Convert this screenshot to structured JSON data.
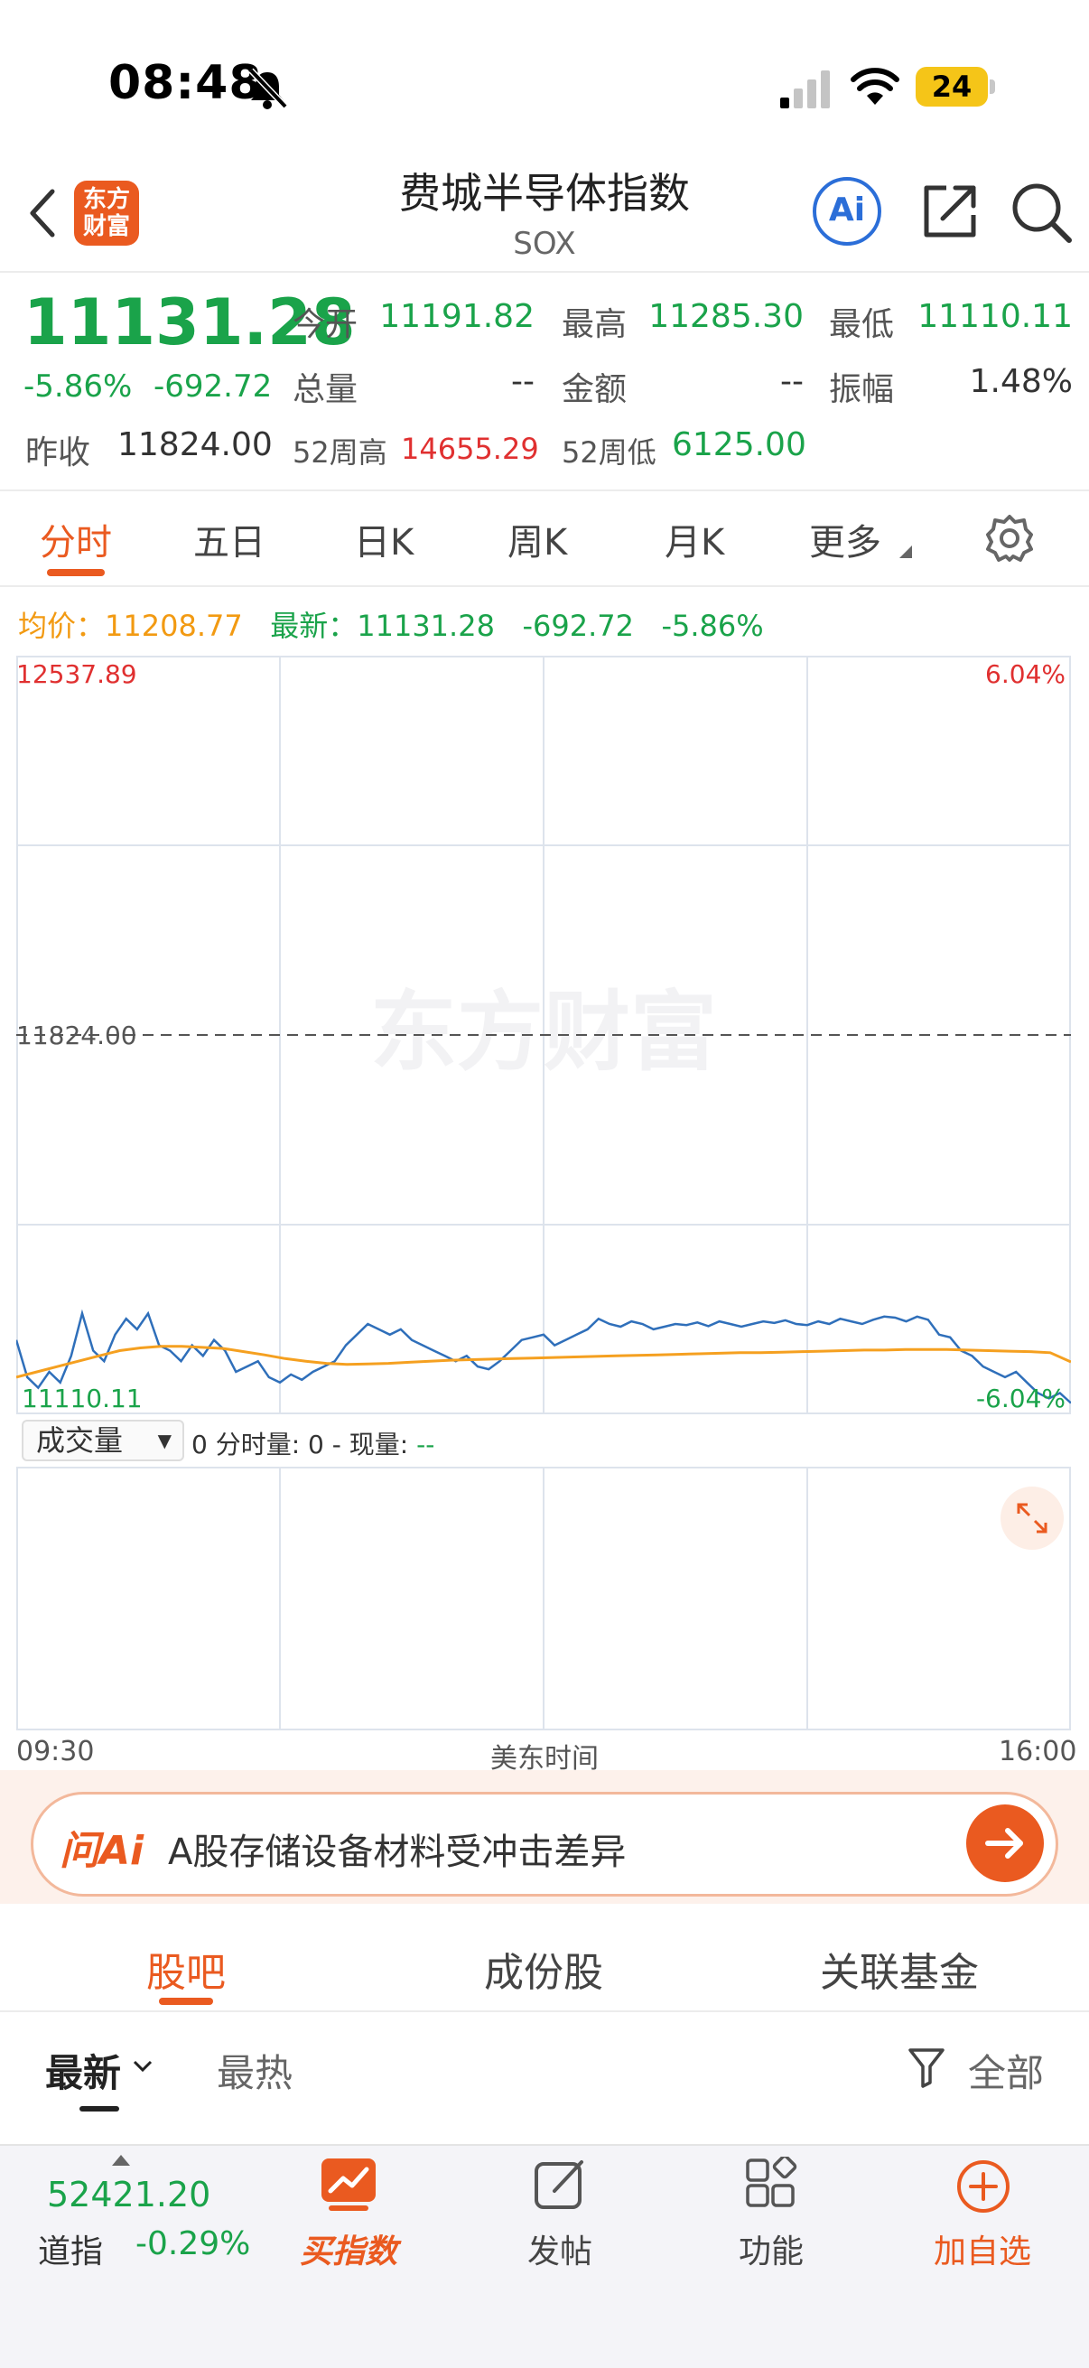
{
  "status_bar": {
    "time": "08:48",
    "battery": "24"
  },
  "header": {
    "logo_line1": "东方",
    "logo_line2": "财富",
    "title": "费城半导体指数",
    "subtitle": "SOX",
    "ai_label": "Ai"
  },
  "quote": {
    "price": "11131.28",
    "change_pct": "-5.86%",
    "change": "-692.72",
    "prev_close_label": "昨收",
    "prev_close": "11824.00",
    "open_label": "今开",
    "open": "11191.82",
    "high_label": "最高",
    "high": "11285.30",
    "low_label": "最低",
    "low": "11110.11",
    "volume_label": "总量",
    "volume": "--",
    "amount_label": "金额",
    "amount": "--",
    "amplitude_label": "振幅",
    "amplitude": "1.48%",
    "w52_high_label": "52周高",
    "w52_high": "14655.29",
    "w52_low_label": "52周低",
    "w52_low": "6125.00"
  },
  "tabs": [
    "分时",
    "五日",
    "日K",
    "周K",
    "月K",
    "更多"
  ],
  "avg_bar": {
    "avg_label": "均价：",
    "avg": "11208.77",
    "latest_label": "最新：",
    "latest": "11131.28",
    "change": "-692.72",
    "change_pct": "-5.86%"
  },
  "chart_data": {
    "type": "line",
    "y_top": "12537.89",
    "y_mid": "11824.00",
    "y_bottom": "11110.11",
    "pct_top": "6.04%",
    "pct_bottom": "-6.04%",
    "ylim": [
      11110.11,
      12537.89
    ],
    "watermark": "东方财富",
    "series": [
      {
        "values": [
          11250,
          11180,
          11160,
          11190,
          11170,
          11220,
          11300,
          11230,
          11210,
          11260,
          11290,
          11270,
          11300,
          11240,
          11230,
          11210,
          11240,
          11220,
          11250,
          11230,
          11190,
          11200,
          11210,
          11180,
          11170,
          11185,
          11175,
          11190,
          11200,
          11210,
          11240,
          11260,
          11280,
          11270,
          11260,
          11270,
          11250,
          11240,
          11230,
          11220,
          11210,
          11220,
          11200,
          11195,
          11210,
          11230,
          11250,
          11255,
          11260,
          11240,
          11250,
          11260,
          11270,
          11290,
          11280,
          11275,
          11285,
          11280,
          11270,
          11275,
          11280,
          11278,
          11283,
          11276,
          11285,
          11280,
          11275,
          11280,
          11285,
          11282,
          11287,
          11280,
          11278,
          11285,
          11280,
          11290,
          11285,
          11280,
          11288,
          11294,
          11292,
          11285,
          11294,
          11288,
          11260,
          11255,
          11230,
          11220,
          11200,
          11190,
          11180,
          11190,
          11170,
          11150,
          11140,
          11150,
          11131.28
        ]
      },
      {
        "values": [
          11180,
          11190,
          11200,
          11210,
          11220,
          11230,
          11235,
          11238,
          11238,
          11236,
          11234,
          11228,
          11222,
          11215,
          11210,
          11206,
          11204,
          11205,
          11206,
          11208,
          11210,
          11212,
          11213,
          11214,
          11215,
          11216,
          11217,
          11218,
          11219,
          11220,
          11221,
          11222,
          11223,
          11224,
          11225,
          11226,
          11226,
          11227,
          11228,
          11229,
          11230,
          11231,
          11231,
          11232,
          11232,
          11232,
          11231,
          11230,
          11229,
          11228,
          11226,
          11208.77
        ]
      }
    ]
  },
  "volume": {
    "selector": "成交量",
    "info_prefix": "0 分时量: 0 - 现量: ",
    "info_suffix": "--",
    "time_start": "09:30",
    "time_mid": "美东时间",
    "time_end": "16:00"
  },
  "ai_bar": {
    "logo": "问Ai",
    "text": "A股存储设备材料受冲击差异"
  },
  "section_tabs": [
    "股吧",
    "成份股",
    "关联基金"
  ],
  "sort": {
    "latest": "最新",
    "hot": "最热",
    "filter": "全部"
  },
  "bottom_bar": {
    "djia_value": "52421.20",
    "djia_label": "道指",
    "djia_pct": "-0.29%",
    "buy_index": "买指数",
    "post": "发帖",
    "functions": "功能",
    "add_watch": "加自选"
  },
  "colors": {
    "accent": "#ea5a20",
    "down": "#1aa34a",
    "up": "#e03030",
    "price_line": "#2f6fba",
    "avg_line": "#f5a020"
  }
}
